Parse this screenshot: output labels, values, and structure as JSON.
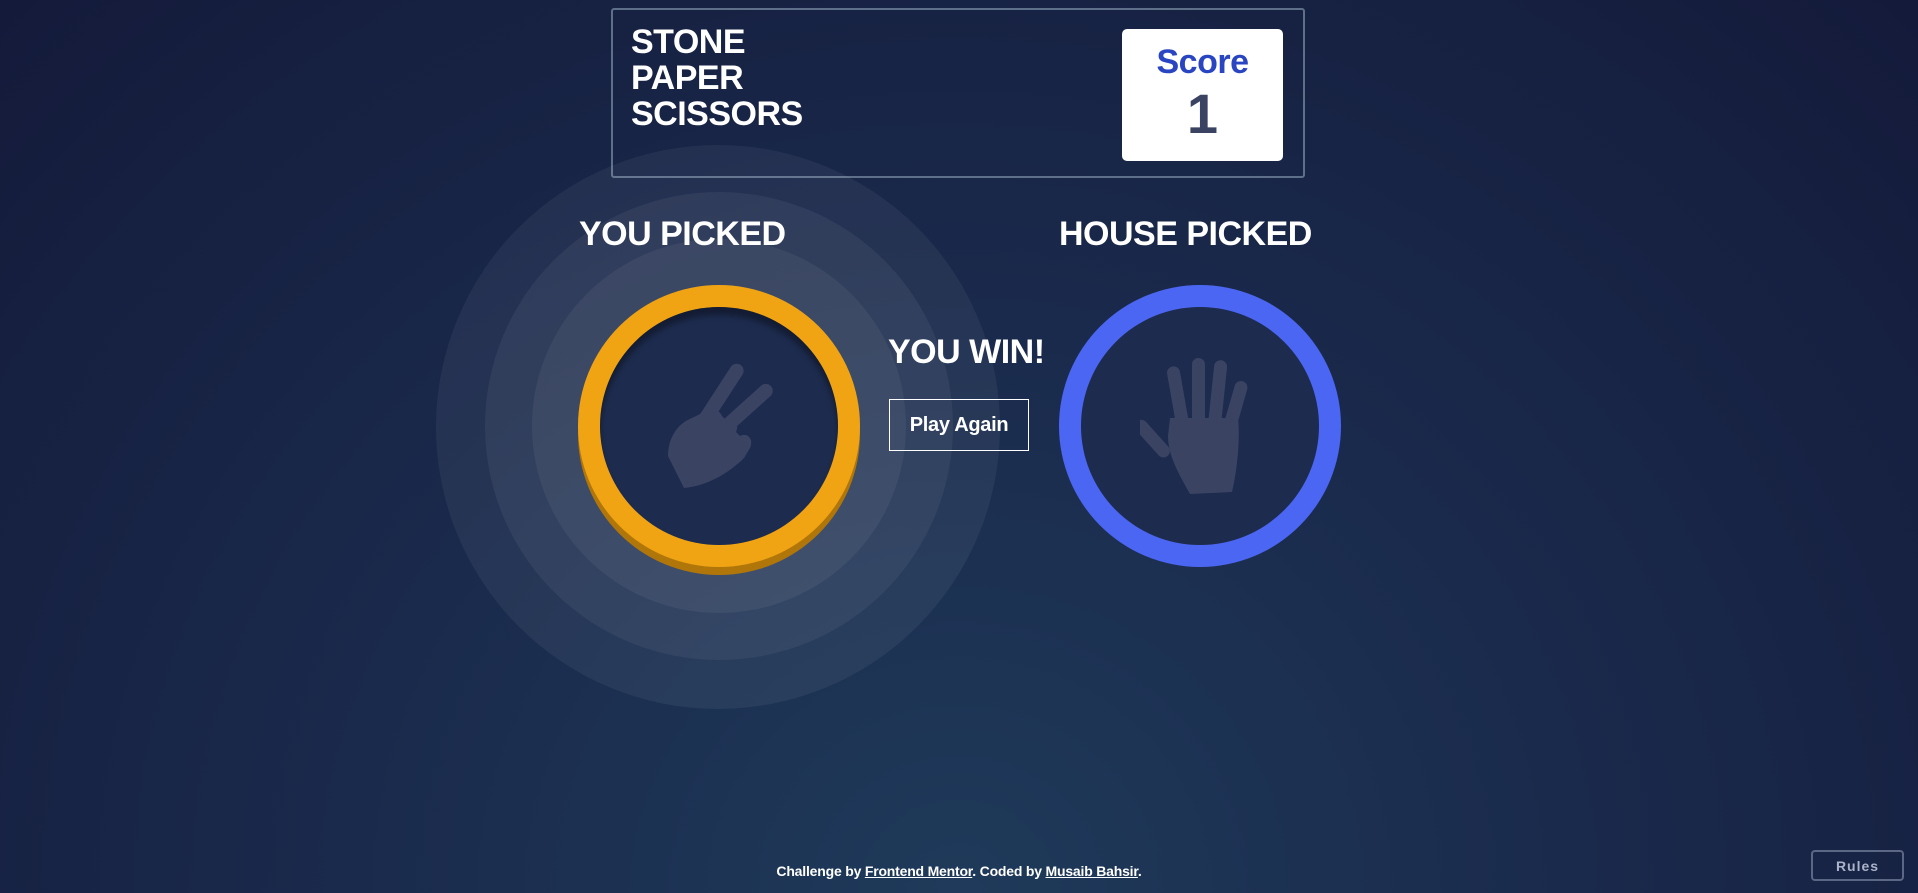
{
  "header": {
    "title_lines": [
      "STONE",
      "PAPER",
      "SCISSORS"
    ],
    "score_label": "Score",
    "score_value": "1"
  },
  "game": {
    "you_picked_label": "YOU PICKED",
    "house_picked_label": "HOUSE PICKED",
    "you_pick": {
      "choice_icon": "scissors-hand-icon",
      "ring_color": "#f0a414"
    },
    "house_pick": {
      "choice_icon": "paper-hand-icon",
      "ring_color": "#4b66f2"
    },
    "result_text": "YOU WIN!",
    "play_again_label": "Play Again"
  },
  "footer": {
    "prefix": "Challenge by ",
    "link1": "Frontend Mentor",
    "middle": ". Coded by ",
    "link2": "Musaib Bahsir",
    "suffix": "."
  },
  "rules_label": "Rules",
  "colors": {
    "icon_fill": "#3b4363",
    "score_label": "#2a45c2"
  }
}
